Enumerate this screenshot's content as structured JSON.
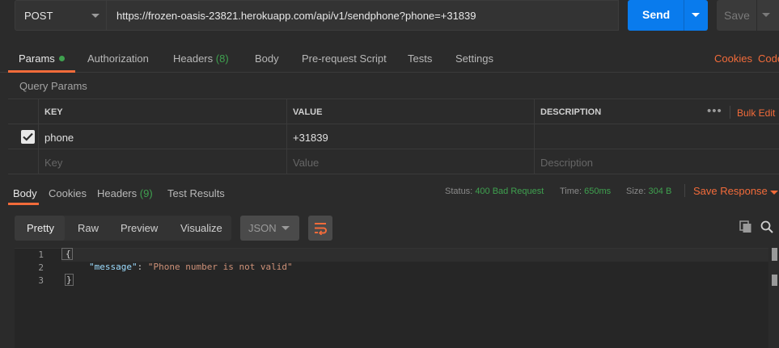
{
  "request": {
    "method": "POST",
    "url": "https://frozen-oasis-23821.herokuapp.com/api/v1/sendphone?phone=+31839",
    "send_label": "Send",
    "save_label": "Save"
  },
  "request_tabs": {
    "params": "Params",
    "authorization": "Authorization",
    "headers": "Headers",
    "headers_count": "(8)",
    "body": "Body",
    "pre_request": "Pre-request Script",
    "tests": "Tests",
    "settings": "Settings",
    "cookies": "Cookies",
    "code": "Code"
  },
  "query_params": {
    "title": "Query Params",
    "columns": {
      "key": "KEY",
      "value": "VALUE",
      "description": "DESCRIPTION"
    },
    "more": "•••",
    "bulk_edit": "Bulk Edit",
    "rows": [
      {
        "key": "phone",
        "value": "+31839",
        "description": "",
        "checked": true
      }
    ],
    "placeholders": {
      "key": "Key",
      "value": "Value",
      "description": "Description"
    }
  },
  "response_tabs": {
    "body": "Body",
    "cookies": "Cookies",
    "headers": "Headers",
    "headers_count": "(9)",
    "test_results": "Test Results"
  },
  "response_status": {
    "status_label": "Status:",
    "status_value": "400 Bad Request",
    "time_label": "Time:",
    "time_value": "650ms",
    "size_label": "Size:",
    "size_value": "304 B",
    "save_response": "Save Response"
  },
  "response_view": {
    "modes": [
      "Pretty",
      "Raw",
      "Preview",
      "Visualize"
    ],
    "active_mode": "Pretty",
    "format": "JSON"
  },
  "response_body": {
    "line_numbers": [
      "1",
      "2",
      "3"
    ],
    "open_brace": "{",
    "key": "\"message\"",
    "colon": ": ",
    "value": "\"Phone number is not valid\"",
    "close_brace": "}"
  },
  "colors": {
    "accent": "#f26b3a",
    "send_blue": "#097bed",
    "success_green": "#3fa14f"
  },
  "icons": [
    "chevron-down-icon",
    "checkmark-icon",
    "wrap-lines-icon",
    "copy-icon",
    "search-icon"
  ]
}
